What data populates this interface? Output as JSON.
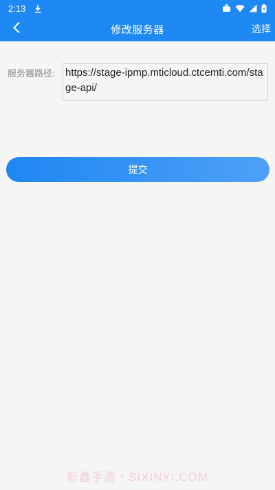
{
  "status_bar": {
    "time": "2:13",
    "icons": [
      "download-icon",
      "briefcase-icon",
      "wifi-icon",
      "signal-icon",
      "battery-icon"
    ]
  },
  "header": {
    "title": "修改服务器",
    "back_icon": "chevron-left-icon",
    "select_label": "选择"
  },
  "form": {
    "server_url_label": "服务器路径:",
    "server_url_value": "https://stage-ipmp.mticloud.ctcemti.com/stage-api/"
  },
  "submit_label": "提交",
  "watermark": "新鑫手游・SIXINYI.COM",
  "colors": {
    "primary": "#1e88f5",
    "background": "#f5f5f5",
    "label_text": "#888888"
  }
}
